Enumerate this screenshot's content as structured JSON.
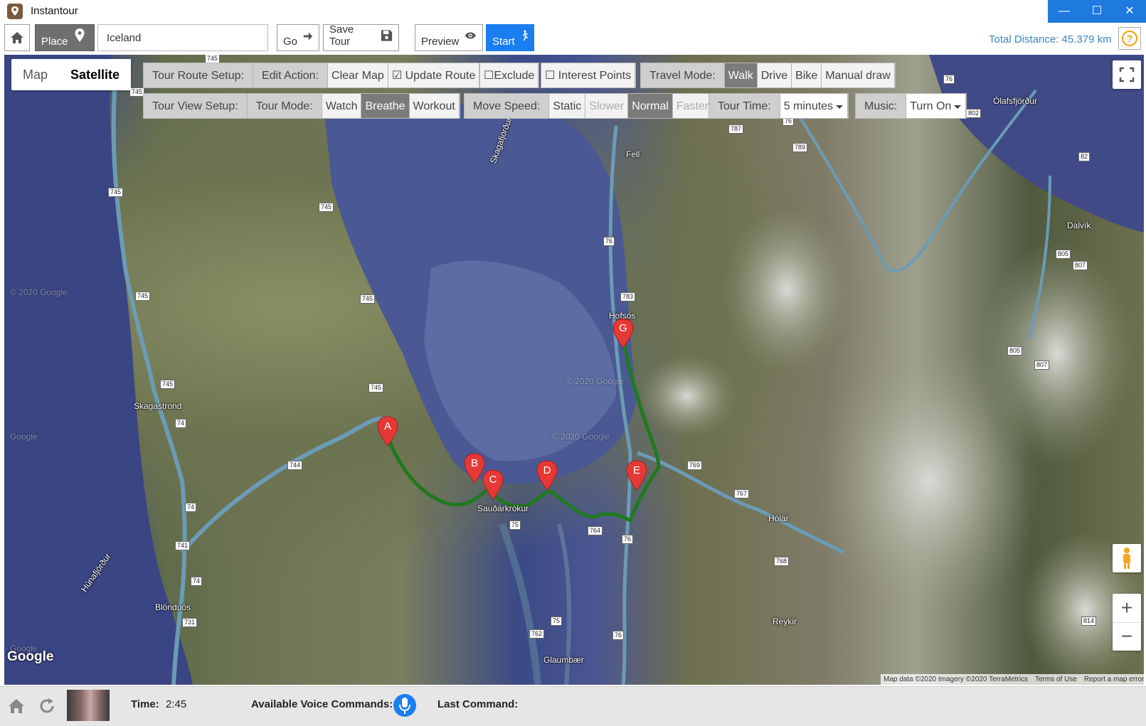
{
  "window": {
    "title": "Instantour"
  },
  "toolbar": {
    "place_label": "Place",
    "place_value": "Iceland",
    "go_label": "Go",
    "save_label": "Save Tour",
    "preview_label": "Preview",
    "start_label": "Start",
    "total_distance": "Total Distance: 45.379 km"
  },
  "map_type": {
    "map": "Map",
    "satellite": "Satellite",
    "selected": "Satellite"
  },
  "route_setup": {
    "label": "Tour Route Setup:",
    "edit_action_label": "Edit Action:",
    "clear_map": "Clear Map",
    "update_route": "Update Route",
    "update_route_checked": true,
    "exclude": "Exclude",
    "exclude_checked": false,
    "interest_points": "Interest Points",
    "interest_points_checked": false,
    "travel_mode_label": "Travel Mode:",
    "travel_modes": [
      "Walk",
      "Drive",
      "Bike",
      "Manual draw"
    ],
    "travel_mode_selected": "Walk"
  },
  "view_setup": {
    "label": "Tour View Setup:",
    "tour_mode_label": "Tour Mode:",
    "tour_modes": [
      "Watch",
      "Breathe",
      "Workout"
    ],
    "tour_mode_selected": "Breathe",
    "move_speed_label": "Move Speed:",
    "speeds": [
      "Static",
      "Slower",
      "Normal",
      "Faster"
    ],
    "speed_selected": "Normal",
    "tour_time_label": "Tour Time:",
    "tour_time_value": "5 minutes",
    "music_label": "Music:",
    "music_value": "Turn On"
  },
  "map": {
    "markers": [
      "A",
      "B",
      "C",
      "D",
      "E",
      "G"
    ],
    "towns": [
      "Ólafsfjörður",
      "Fell",
      "Skagafjörður",
      "Hofsós",
      "Dalvík",
      "Skagastrond",
      "Sauðárkrókur",
      "Hólar",
      "Reykir",
      "Blönduós",
      "Húnafjörður",
      "Glaumbær"
    ],
    "roads": [
      "745",
      "76",
      "802",
      "787",
      "789",
      "82",
      "805",
      "807",
      "783",
      "74",
      "744",
      "75",
      "764",
      "769",
      "767",
      "768",
      "741",
      "731",
      "762",
      "814"
    ],
    "watermarks": [
      "© 2020 Google",
      "Google"
    ],
    "attribution": "Map data ©2020 Imagery ©2020 TerraMetrics",
    "terms": "Terms of Use",
    "report": "Report a map error",
    "google_logo": "Google",
    "route_color": "#1f7a1f",
    "marker_color": "#e53935"
  },
  "status": {
    "time_label": "Time:",
    "time_value": "2:45",
    "voice_label": "Available Voice Commands:",
    "last_command_label": "Last Command:",
    "last_command_value": ""
  }
}
